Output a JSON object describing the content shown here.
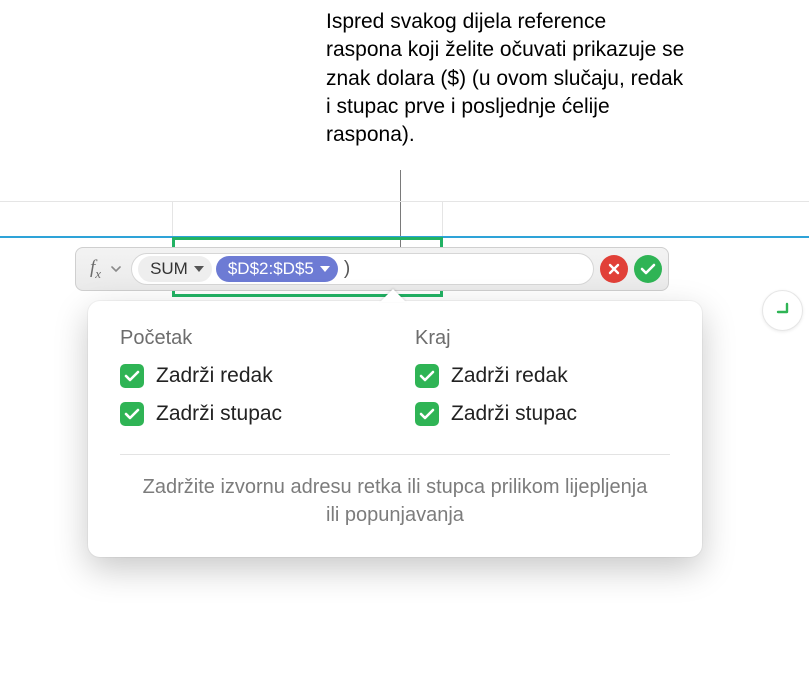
{
  "annotation": "Ispred svakog dijela reference raspona koji želite očuvati prikazuje se znak dolara ($) (u ovom slučaju, redak i stupac prve i posljednje ćelije raspona).",
  "formula_bar": {
    "fx_label_main": "f",
    "fx_label_sub": "x",
    "function_token": "SUM",
    "range_token": "$D$2:$D$5",
    "closing_paren": ")"
  },
  "popover": {
    "start_heading": "Početak",
    "end_heading": "Kraj",
    "keep_row": "Zadrži redak",
    "keep_column": "Zadrži stupac",
    "help_text": "Zadržite izvornu adresu retka ili stupca prilikom lijepljenja ili popunjavanja"
  }
}
